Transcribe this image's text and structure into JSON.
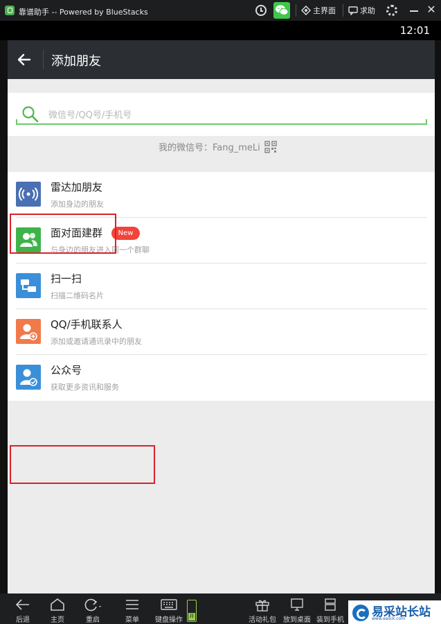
{
  "emulator": {
    "title": "靠谱助手 -- Powered by BlueStacks",
    "home_label": "主界面",
    "help_label": "求助",
    "bottom_tools": [
      {
        "label": "后退",
        "icon": "back-arrow-icon"
      },
      {
        "label": "主页",
        "icon": "home-icon"
      },
      {
        "label": "重启",
        "icon": "restart-icon"
      },
      {
        "label": "菜单",
        "icon": "menu-icon"
      },
      {
        "label": "键盘操作",
        "icon": "keyboard-icon"
      },
      {
        "label": "活动礼包",
        "icon": "gift-icon"
      },
      {
        "label": "放到桌面",
        "icon": "desktop-icon"
      },
      {
        "label": "装到手机",
        "icon": "phone-install-icon"
      }
    ],
    "keyboard_toggle": "开"
  },
  "status_bar": {
    "time": "12:01"
  },
  "header": {
    "title": "添加朋友"
  },
  "search": {
    "placeholder": "微信号/QQ号/手机号"
  },
  "my_id": {
    "text": "我的微信号：Fang_meLi"
  },
  "items": [
    {
      "label": "雷达加朋友",
      "sub": "添加身边的朋友",
      "icon": "radar-icon",
      "color": "#4a6fb3",
      "highlighted": true
    },
    {
      "label": "面对面建群",
      "sub": "与身边的朋友进入同一个群聊",
      "icon": "group-icon",
      "color": "#3eb34a",
      "badge": "New"
    },
    {
      "label": "扫一扫",
      "sub": "扫描二维码名片",
      "icon": "scan-icon",
      "color": "#3a8fd8"
    },
    {
      "label": "QQ/手机联系人",
      "sub": "添加或邀请通讯录中的朋友",
      "icon": "contact-add-icon",
      "color": "#f07a4a",
      "highlighted": true
    },
    {
      "label": "公众号",
      "sub": "获取更多资讯和服务",
      "icon": "official-account-icon",
      "color": "#3a8fd8"
    }
  ],
  "watermark": {
    "text": "易采站长站",
    "url": "www.easck.com"
  }
}
